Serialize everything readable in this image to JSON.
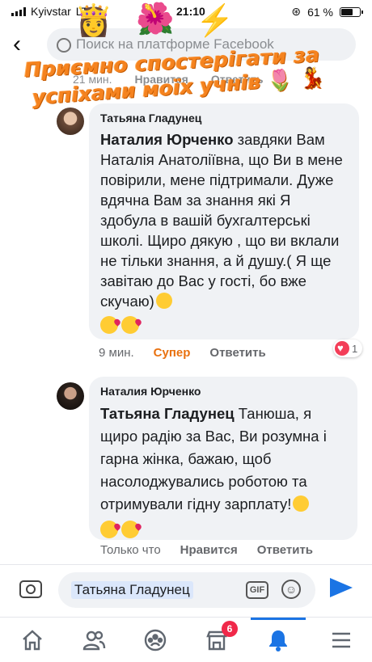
{
  "status_bar": {
    "carrier": "Kyivstar",
    "network": "LTE",
    "time": "21:10",
    "battery": "61 %"
  },
  "header": {
    "search_placeholder": "Поиск на платформе Facebook"
  },
  "overlay": {
    "line1": "Приємно  спостерігати за",
    "line2": "успіхами моїх учнів"
  },
  "top_meta": {
    "time": "21 мин.",
    "like": "Нравится",
    "reply": "Ответить"
  },
  "comments": [
    {
      "author": "Татьяна Гладунец",
      "mention": "Наталия Юрченко",
      "text": "  завдяки Вам Наталія Анатоліївна, що Ви в мене повірили, мене підтримали. Дуже вдячна Вам за знання які Я здобула в вашій бухгалтерські школі. Щиро дякую , що ви вклали не тільки знання, а й душу.( Я ще завітаю до Вас у гості, бо вже скучаю)",
      "time": "9 мин.",
      "reaction": "Супер",
      "reply": "Ответить",
      "reaction_count": "1"
    },
    {
      "author": "Наталия Юрченко",
      "mention": "Татьяна Гладунец",
      "text": " Танюша, я щиро радію за Вас, Ви розумна і гарна жінка, бажаю, щоб насолоджувались роботою та отримували гідну зарплату!",
      "time": "Только что",
      "like": "Нравится",
      "reply": "Ответить"
    }
  ],
  "composer": {
    "mention": "Татьяна Гладунец",
    "gif_label": "GIF"
  },
  "tab_bar": {
    "notifications_badge": "6"
  },
  "colors": {
    "accent": "#1b74e4",
    "super_reaction": "#e9710f",
    "overlay_text": "#f5831f",
    "badge": "#f02849"
  }
}
